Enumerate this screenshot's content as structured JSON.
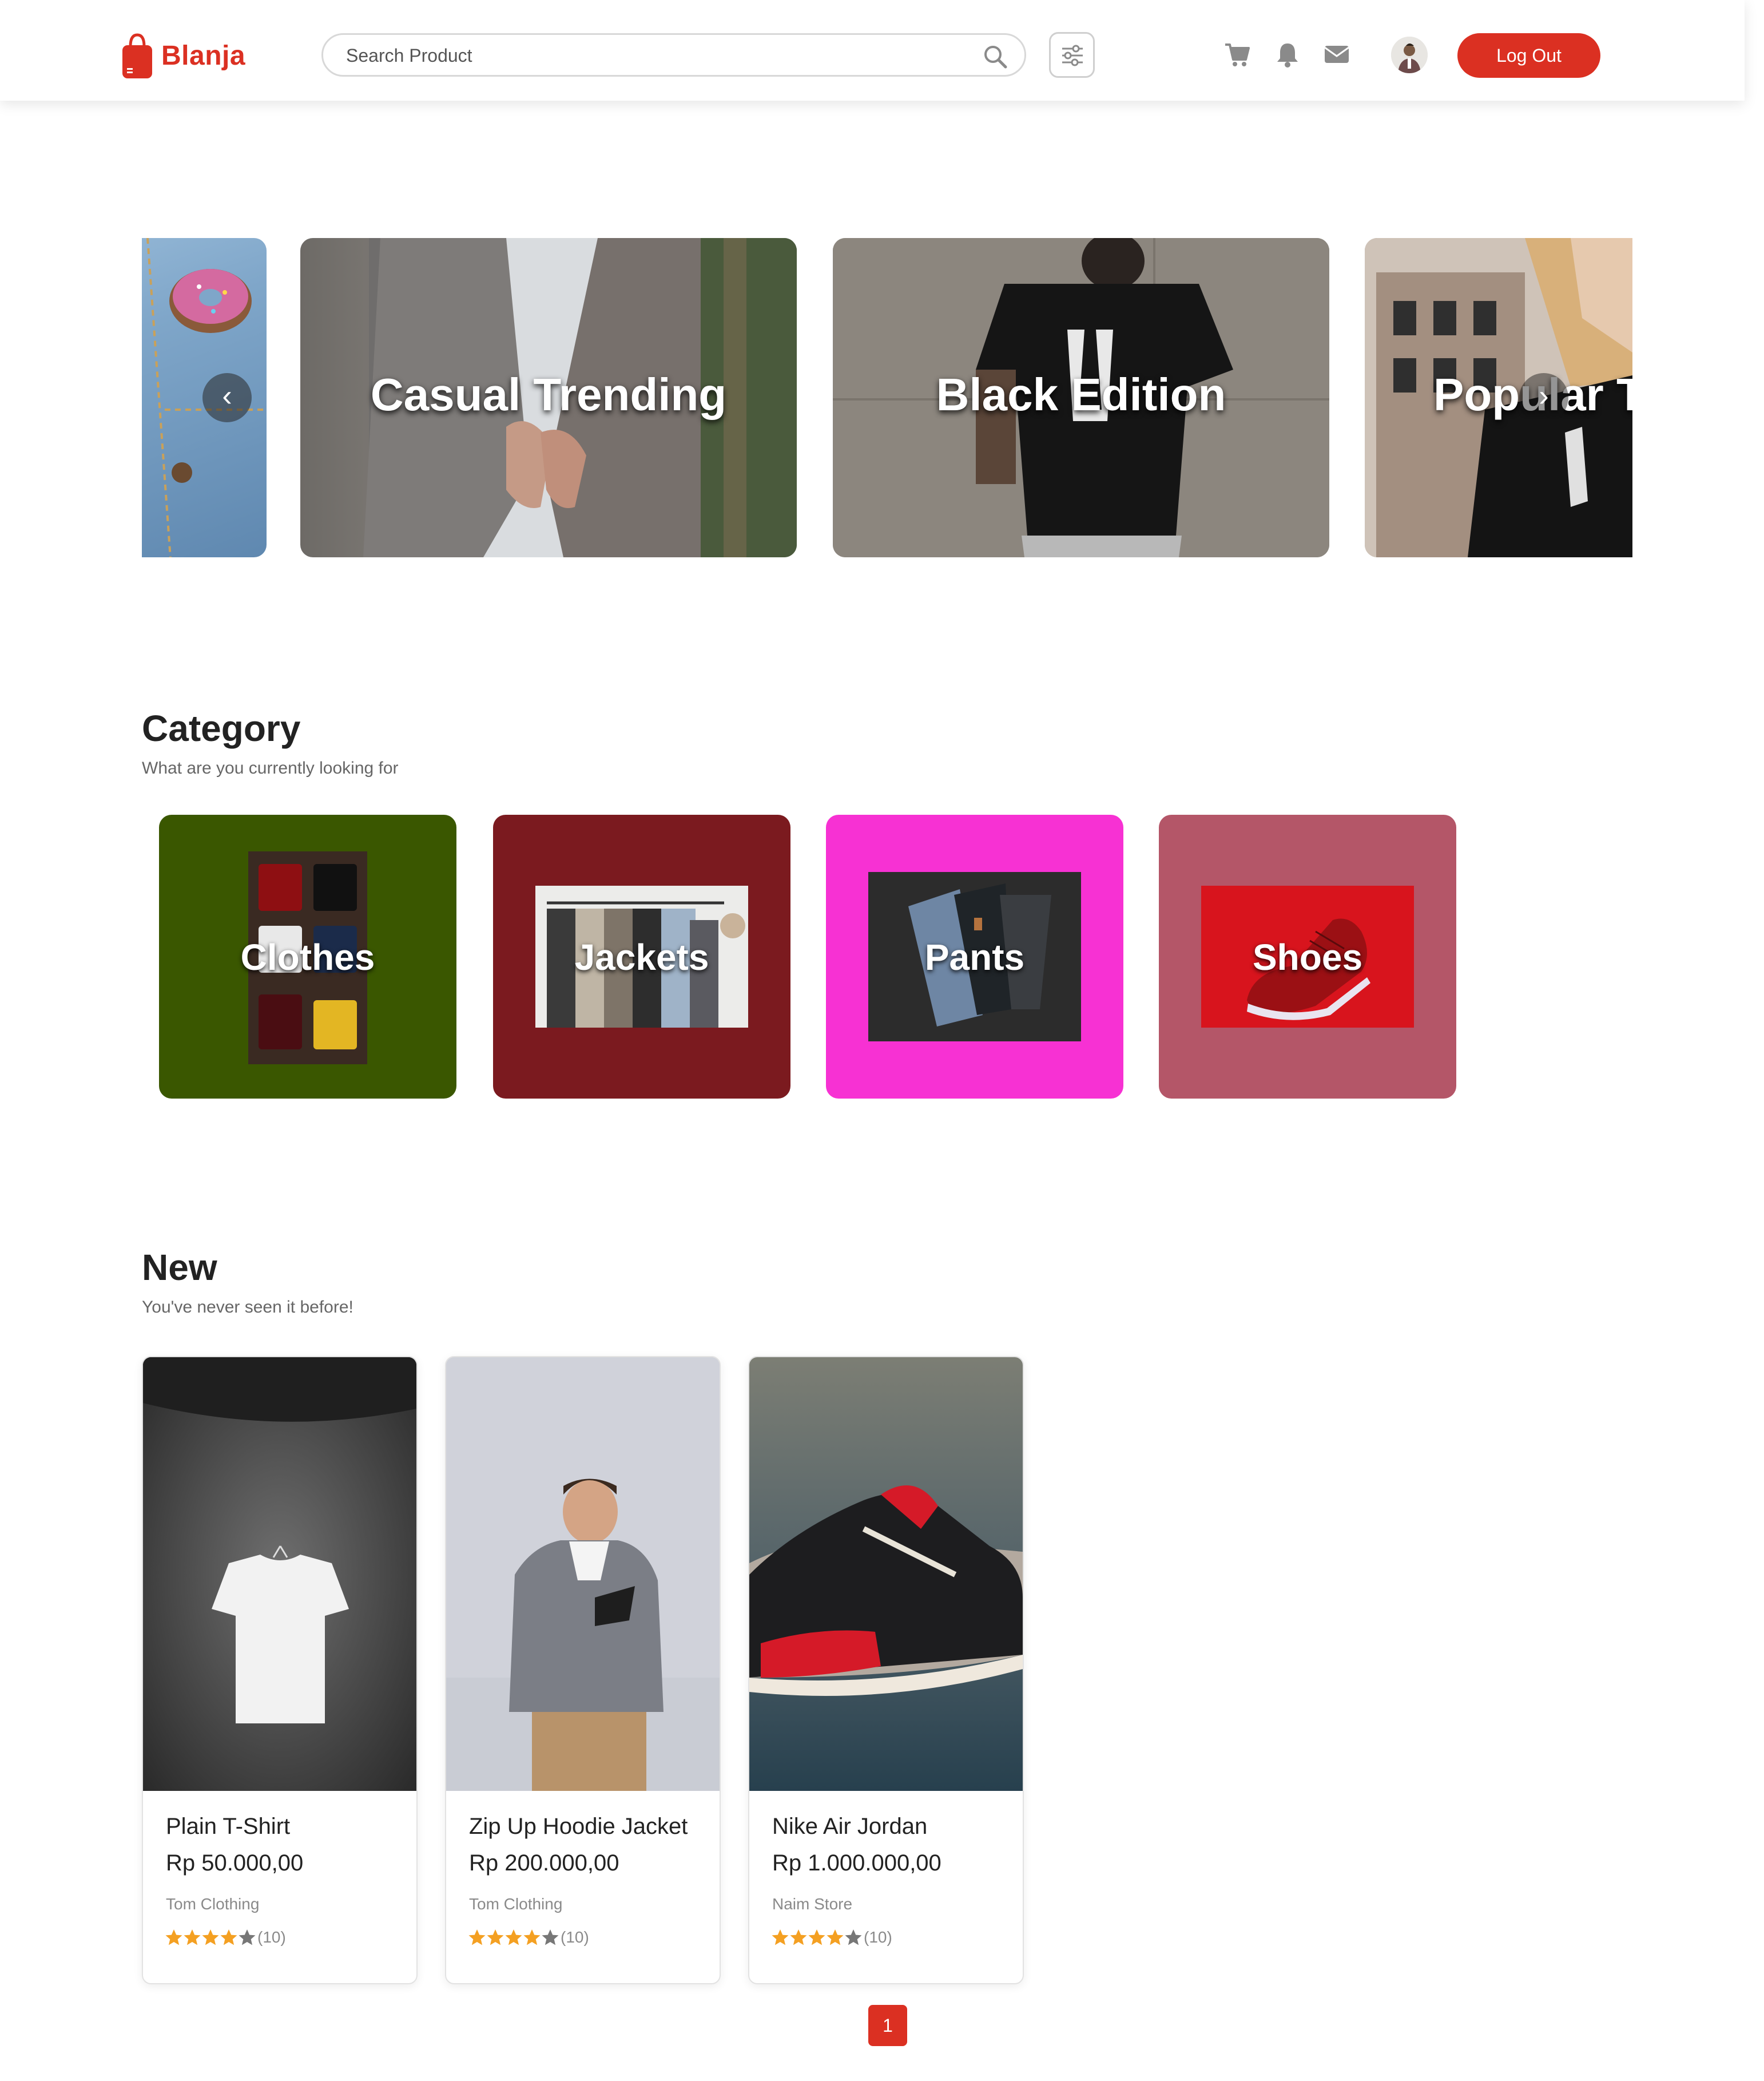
{
  "navbar": {
    "brand": "Blanja",
    "search_placeholder": "Search Product",
    "logout_label": "Log Out",
    "icons": [
      "search-icon",
      "filter-icon",
      "cart-icon",
      "bell-icon",
      "mail-icon",
      "user-avatar"
    ]
  },
  "carousel": {
    "slides": [
      {
        "title": ""
      },
      {
        "title": "Casual Trending"
      },
      {
        "title": "Black Edition"
      },
      {
        "title": "Popular Top"
      }
    ],
    "prev_label": "‹",
    "next_label": "›"
  },
  "category": {
    "title": "Category",
    "subtitle": "What are you currently looking for",
    "items": [
      {
        "label": "Clothes",
        "color": "#3A5700"
      },
      {
        "label": "Jackets",
        "color": "#7B1A1F"
      },
      {
        "label": "Pants",
        "color": "#F731D3"
      },
      {
        "label": "Shoes",
        "color": "#B45668"
      }
    ]
  },
  "new": {
    "title": "New",
    "subtitle": "You've never seen it before!",
    "products": [
      {
        "name": "Plain T-Shirt",
        "price": "Rp 50.000,00",
        "store": "Tom Clothing",
        "rating": 4,
        "rating_count": "(10)"
      },
      {
        "name": "Zip Up Hoodie Jacket",
        "price": "Rp 200.000,00",
        "store": "Tom Clothing",
        "rating": 4,
        "rating_count": "(10)"
      },
      {
        "name": "Nike Air Jordan",
        "price": "Rp 1.000.000,00",
        "store": "Naim Store",
        "rating": 4,
        "rating_count": "(10)"
      }
    ]
  },
  "pagination": {
    "current": "1"
  },
  "colors": {
    "accent": "#DB3022",
    "star": "#F4A022",
    "star_empty": "#777777"
  }
}
